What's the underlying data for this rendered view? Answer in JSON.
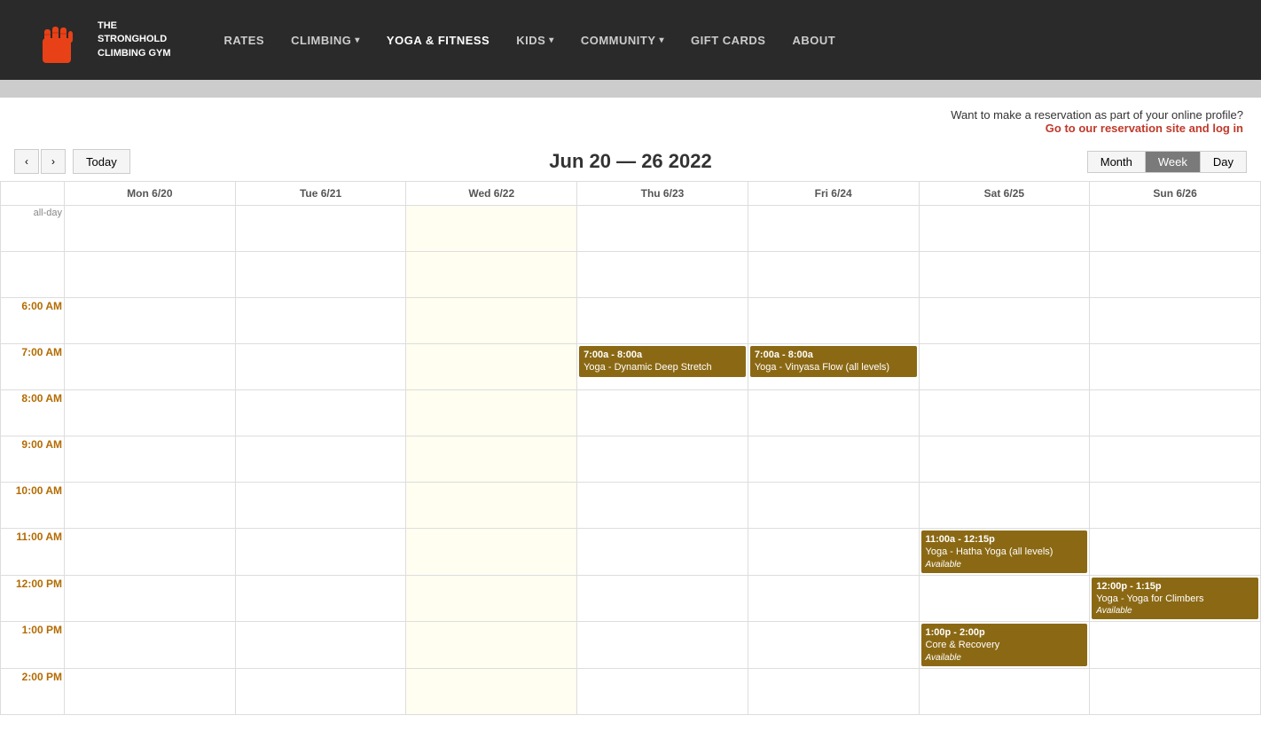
{
  "header": {
    "logo_text": "THE STRONGHOLD CLIMBING GYM",
    "nav_items": [
      {
        "label": "RATES",
        "has_dropdown": false
      },
      {
        "label": "CLIMBING",
        "has_dropdown": true
      },
      {
        "label": "YOGA & FITNESS",
        "has_dropdown": false
      },
      {
        "label": "KIDS",
        "has_dropdown": true
      },
      {
        "label": "COMMUNITY",
        "has_dropdown": true
      },
      {
        "label": "GIFT CARDS",
        "has_dropdown": false
      },
      {
        "label": "ABOUT",
        "has_dropdown": false
      }
    ]
  },
  "reservation": {
    "notice": "Want to make a reservation as part of your online profile?",
    "link_text": "Go to our reservation site and log in"
  },
  "calendar": {
    "prev_label": "‹",
    "next_label": "›",
    "today_label": "Today",
    "title": "Jun 20 — 26 2022",
    "view_month": "Month",
    "view_week": "Week",
    "view_day": "Day",
    "days": [
      {
        "label": "Mon 6/20",
        "today": false
      },
      {
        "label": "Tue 6/21",
        "today": false
      },
      {
        "label": "Wed 6/22",
        "today": true
      },
      {
        "label": "Thu 6/23",
        "today": false
      },
      {
        "label": "Fri 6/24",
        "today": false
      },
      {
        "label": "Sat 6/25",
        "today": false
      },
      {
        "label": "Sun 6/26",
        "today": false
      }
    ],
    "time_slots": [
      "6:00 AM",
      "7:00 AM",
      "8:00 AM",
      "9:00 AM",
      "10:00 AM",
      "11:00 AM",
      "12:00 PM",
      "1:00 PM",
      "2:00 PM"
    ],
    "events": [
      {
        "day_index": 3,
        "time_slot_index": 1,
        "time": "7:00a - 8:00a",
        "title": "Yoga - Dynamic Deep Stretch",
        "available": null
      },
      {
        "day_index": 4,
        "time_slot_index": 1,
        "time": "7:00a - 8:00a",
        "title": "Yoga - Vinyasa Flow (all levels)",
        "available": null
      },
      {
        "day_index": 5,
        "time_slot_index": 5,
        "time": "11:00a - 12:15p",
        "title": "Yoga - Hatha Yoga (all levels)",
        "available": "Available"
      },
      {
        "day_index": 6,
        "time_slot_index": 6,
        "time": "12:00p - 1:15p",
        "title": "Yoga - Yoga for Climbers",
        "available": "Available"
      },
      {
        "day_index": 5,
        "time_slot_index": 7,
        "time": "1:00p - 2:00p",
        "title": "Core & Recovery",
        "available": "Available"
      }
    ]
  }
}
